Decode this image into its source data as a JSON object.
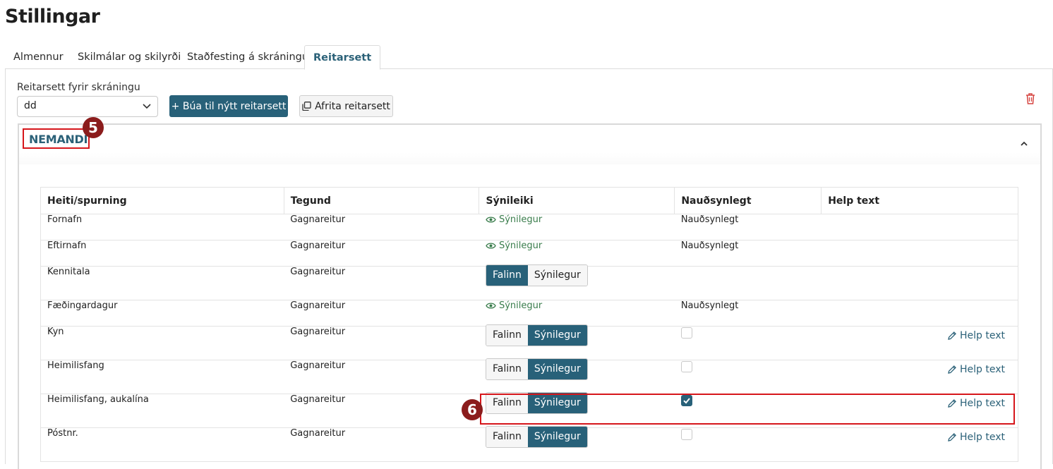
{
  "page": {
    "title": "Stillingar"
  },
  "tabs": [
    {
      "label": "Almennur",
      "active": false
    },
    {
      "label": "Skilmálar og skilyrði",
      "active": false
    },
    {
      "label": "Staðfesting á skráningu",
      "active": false
    },
    {
      "label": "Reitarsett",
      "active": true
    }
  ],
  "toolbar": {
    "select_label": "Reitarsett fyrir skráningu",
    "select_value": "dd",
    "create_button": "+ Búa til nýtt reitarsett",
    "copy_button": "Afrita reitarsett"
  },
  "section": {
    "title": "NEMANDI",
    "marker": "5"
  },
  "table": {
    "headers": [
      "Heiti/spurning",
      "Tegund",
      "Sýnileiki",
      "Nauðsynlegt",
      "Help text"
    ],
    "rows": [
      {
        "name": "Fornafn",
        "type": "Gagnareitur",
        "visibility": "label",
        "visibility_label": "Sýnilegur",
        "required": "Nauðsynlegt",
        "help": ""
      },
      {
        "name": "Eftirnafn",
        "type": "Gagnareitur",
        "visibility": "label",
        "visibility_label": "Sýnilegur",
        "required": "Nauðsynlegt",
        "help": ""
      },
      {
        "name": "Kennitala",
        "type": "Gagnareitur",
        "visibility": "toggle",
        "hidden_label": "Falinn",
        "visible_label": "Sýnilegur",
        "selected": "hidden",
        "required": "",
        "help": ""
      },
      {
        "name": "Fæðingardagur",
        "type": "Gagnareitur",
        "visibility": "label",
        "visibility_label": "Sýnilegur",
        "required": "Nauðsynlegt",
        "help": ""
      },
      {
        "name": "Kyn",
        "type": "Gagnareitur",
        "visibility": "toggle",
        "hidden_label": "Falinn",
        "visible_label": "Sýnilegur",
        "selected": "visible",
        "required_checked": false,
        "help": "Help text"
      },
      {
        "name": "Heimilisfang",
        "type": "Gagnareitur",
        "visibility": "toggle",
        "hidden_label": "Falinn",
        "visible_label": "Sýnilegur",
        "selected": "visible",
        "required_checked": false,
        "help": "Help text"
      },
      {
        "name": "Heimilisfang, aukalína",
        "type": "Gagnareitur",
        "visibility": "toggle",
        "hidden_label": "Falinn",
        "visible_label": "Sýnilegur",
        "selected": "visible",
        "required_checked": true,
        "help": "Help text"
      },
      {
        "name": "Póstnr.",
        "type": "Gagnareitur",
        "visibility": "toggle",
        "hidden_label": "Falinn",
        "visible_label": "Sýnilegur",
        "selected": "visible",
        "required_checked": false,
        "help": "Help text"
      }
    ]
  },
  "annotations": {
    "row_marker": "6"
  },
  "colors": {
    "primary": "#286179",
    "visible_green": "#3a7d4c",
    "annotation_red": "#d6161b",
    "marker_bg": "#8b1c1c",
    "trash_red": "#d64541"
  }
}
